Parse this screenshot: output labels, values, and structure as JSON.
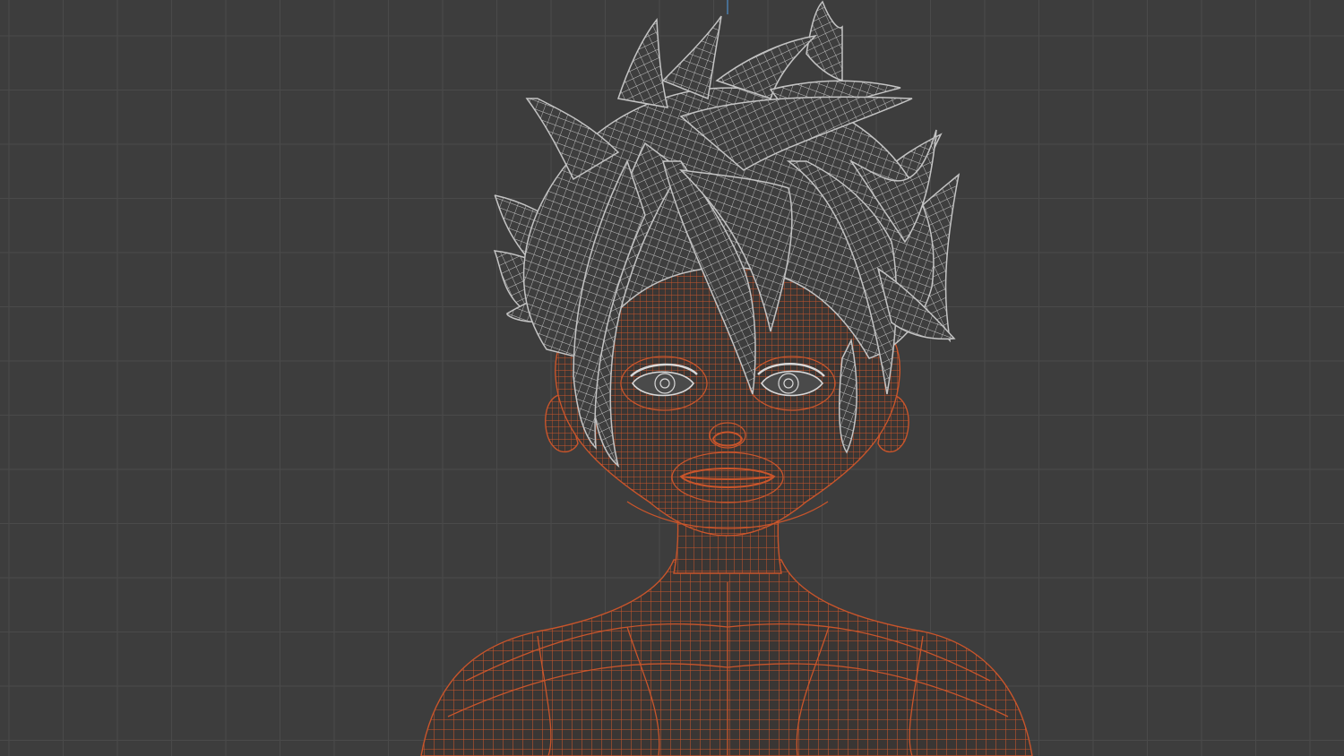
{
  "viewport": {
    "background_color": "#3d3d3d",
    "grid_color": "#4a4a4a",
    "axis_color": "#4f8fc9",
    "show_grid": true
  },
  "mesh": {
    "body": {
      "name": "body-mesh",
      "wire_color": "#c9552b",
      "fill_color": "#3a3634",
      "selected": true
    },
    "hair": {
      "name": "hair-mesh",
      "wire_color": "#c4c4c4",
      "fill_color": "#3e3e3e",
      "selected": false
    },
    "eyes": {
      "wire_color": "#d8d8d8"
    }
  }
}
